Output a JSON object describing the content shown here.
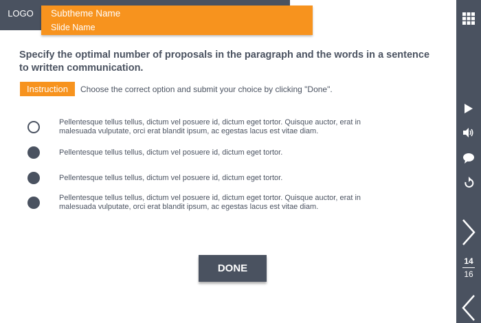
{
  "header": {
    "logo": "LOGO",
    "subtheme": "Subtheme Name",
    "slide": "Slide Name"
  },
  "question": "Specify the optimal number of proposals in the paragraph and the words in a sentence to written communication.",
  "instruction": {
    "badge": "Instruction",
    "text": "Choose the correct option and submit your choice by clicking \"Done\"."
  },
  "options": [
    {
      "text": "Pellentesque tellus tellus, dictum vel posuere id, dictum eget tortor. Quisque auctor, erat in malesuada vulputate, orci erat blandit ipsum, ac egestas lacus est vitae diam.",
      "selected": false
    },
    {
      "text": "Pellentesque tellus tellus, dictum vel posuere id, dictum eget tortor.",
      "selected": false
    },
    {
      "text": "Pellentesque tellus tellus, dictum vel posuere id, dictum eget tortor.",
      "selected": false
    },
    {
      "text": "Pellentesque tellus tellus, dictum vel posuere id, dictum eget tortor. Quisque auctor, erat in malesuada vulputate, orci erat blandit ipsum, ac egestas lacus est vitae diam.",
      "selected": false
    }
  ],
  "done_label": "DONE",
  "sidebar": {
    "icons": [
      "grid-menu-icon",
      "play-icon",
      "volume-icon",
      "comment-icon",
      "replay-icon",
      "chevron-right-icon",
      "chevron-left-icon"
    ],
    "current_page": "14",
    "total_pages": "16"
  },
  "colors": {
    "dark": "#4a5260",
    "accent": "#f7931e"
  }
}
